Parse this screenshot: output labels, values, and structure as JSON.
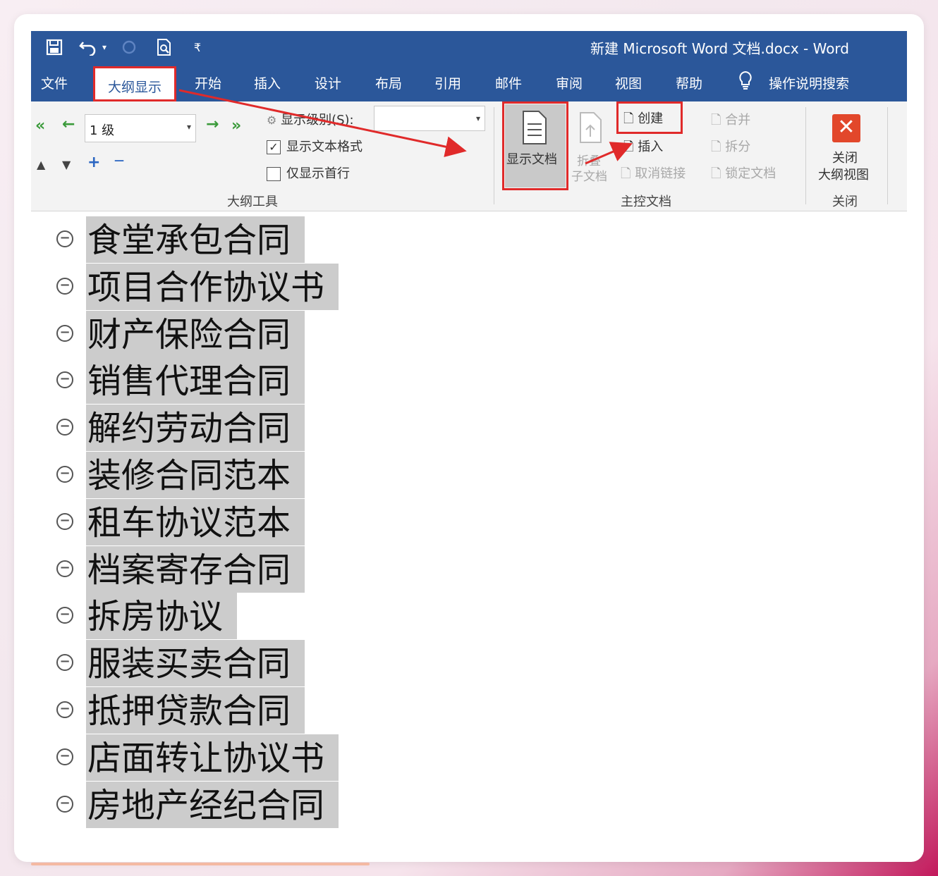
{
  "window": {
    "title": "新建 Microsoft Word 文档.docx  -  Word"
  },
  "quick_access": {
    "icons": [
      "save-icon",
      "undo-icon",
      "redo-icon",
      "print-preview-icon",
      "customize-icon"
    ],
    "undo_dropdown": "▾",
    "customize": "₹"
  },
  "tabs": [
    {
      "label": "文件"
    },
    {
      "label": "大纲显示",
      "active": true
    },
    {
      "label": "开始"
    },
    {
      "label": "插入"
    },
    {
      "label": "设计"
    },
    {
      "label": "布局"
    },
    {
      "label": "引用"
    },
    {
      "label": "邮件"
    },
    {
      "label": "审阅"
    },
    {
      "label": "视图"
    },
    {
      "label": "帮助"
    },
    {
      "label": "操作说明搜索"
    }
  ],
  "ribbon": {
    "outline_tools": {
      "promote_to_heading": "«",
      "promote": "←",
      "level_value": "1 级",
      "demote": "→",
      "demote_to_body": "»",
      "move_up": "▲",
      "move_down": "▼",
      "expand": "+",
      "collapse": "—",
      "show_level_label": "显示级别(S):",
      "show_level_value": "",
      "show_text_formatting": "显示文本格式",
      "show_text_formatting_checked": true,
      "show_first_line_only": "仅显示首行",
      "show_first_line_only_checked": false,
      "group_label": "大纲工具"
    },
    "master_document": {
      "show_document": "显示文档",
      "collapse_subdocuments_1": "折叠",
      "collapse_subdocuments_2": "子文档",
      "create": "创建",
      "insert": "插入",
      "unlink": "取消链接",
      "merge": "合并",
      "split": "拆分",
      "lock_document": "锁定文档",
      "group_label": "主控文档"
    },
    "close": {
      "close_outline_view_1": "关闭",
      "close_outline_view_2": "大纲视图",
      "group_label": "关闭"
    }
  },
  "outline_items": [
    "食堂承包合同",
    "项目合作协议书",
    "财产保险合同",
    "销售代理合同",
    "解约劳动合同",
    "装修合同范本",
    "租车协议范本",
    "档案寄存合同",
    "拆房协议",
    "服装买卖合同",
    "抵押贷款合同",
    "店面转让协议书",
    "房地产经纪合同"
  ],
  "colors": {
    "ribbon_blue": "#2b579a",
    "highlight_red": "#e02a2a",
    "selection_gray": "#cccccc"
  }
}
